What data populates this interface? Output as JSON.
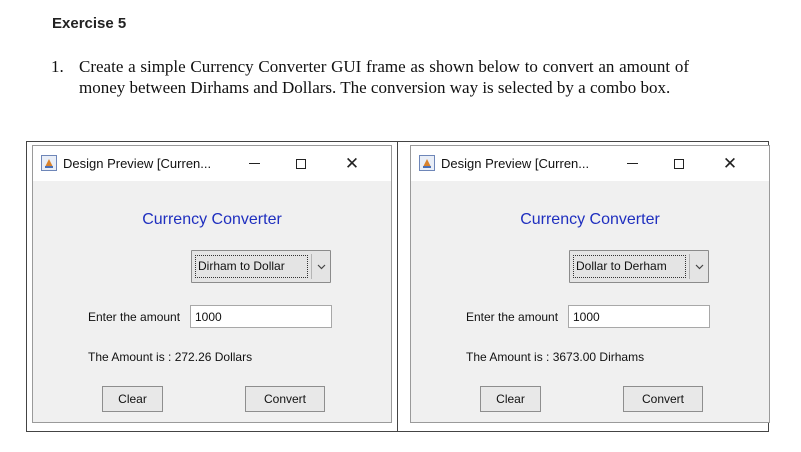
{
  "document": {
    "heading": "Exercise 5",
    "item_number": "1.",
    "item_text": "Create a simple Currency Converter GUI frame as shown below to convert an amount of money between Dirhams and Dollars. The conversion way is selected by a combo box."
  },
  "windows": [
    {
      "title": "Design Preview [Curren...",
      "app_title": "Currency Converter",
      "combo_value": "Dirham to Dollar",
      "amount_label": "Enter the amount",
      "amount_value": "1000",
      "result_text": "The Amount is : 272.26 Dollars",
      "clear_label": "Clear",
      "convert_label": "Convert"
    },
    {
      "title": "Design Preview [Curren...",
      "app_title": "Currency Converter",
      "combo_value": "Dollar to Derham",
      "amount_label": "Enter the amount",
      "amount_value": "1000",
      "result_text": "The Amount is : 3673.00 Dirhams",
      "clear_label": "Clear",
      "convert_label": "Convert"
    }
  ],
  "colors": {
    "app_title": "#1f2fbf",
    "window_bg": "#f0f0f0"
  }
}
